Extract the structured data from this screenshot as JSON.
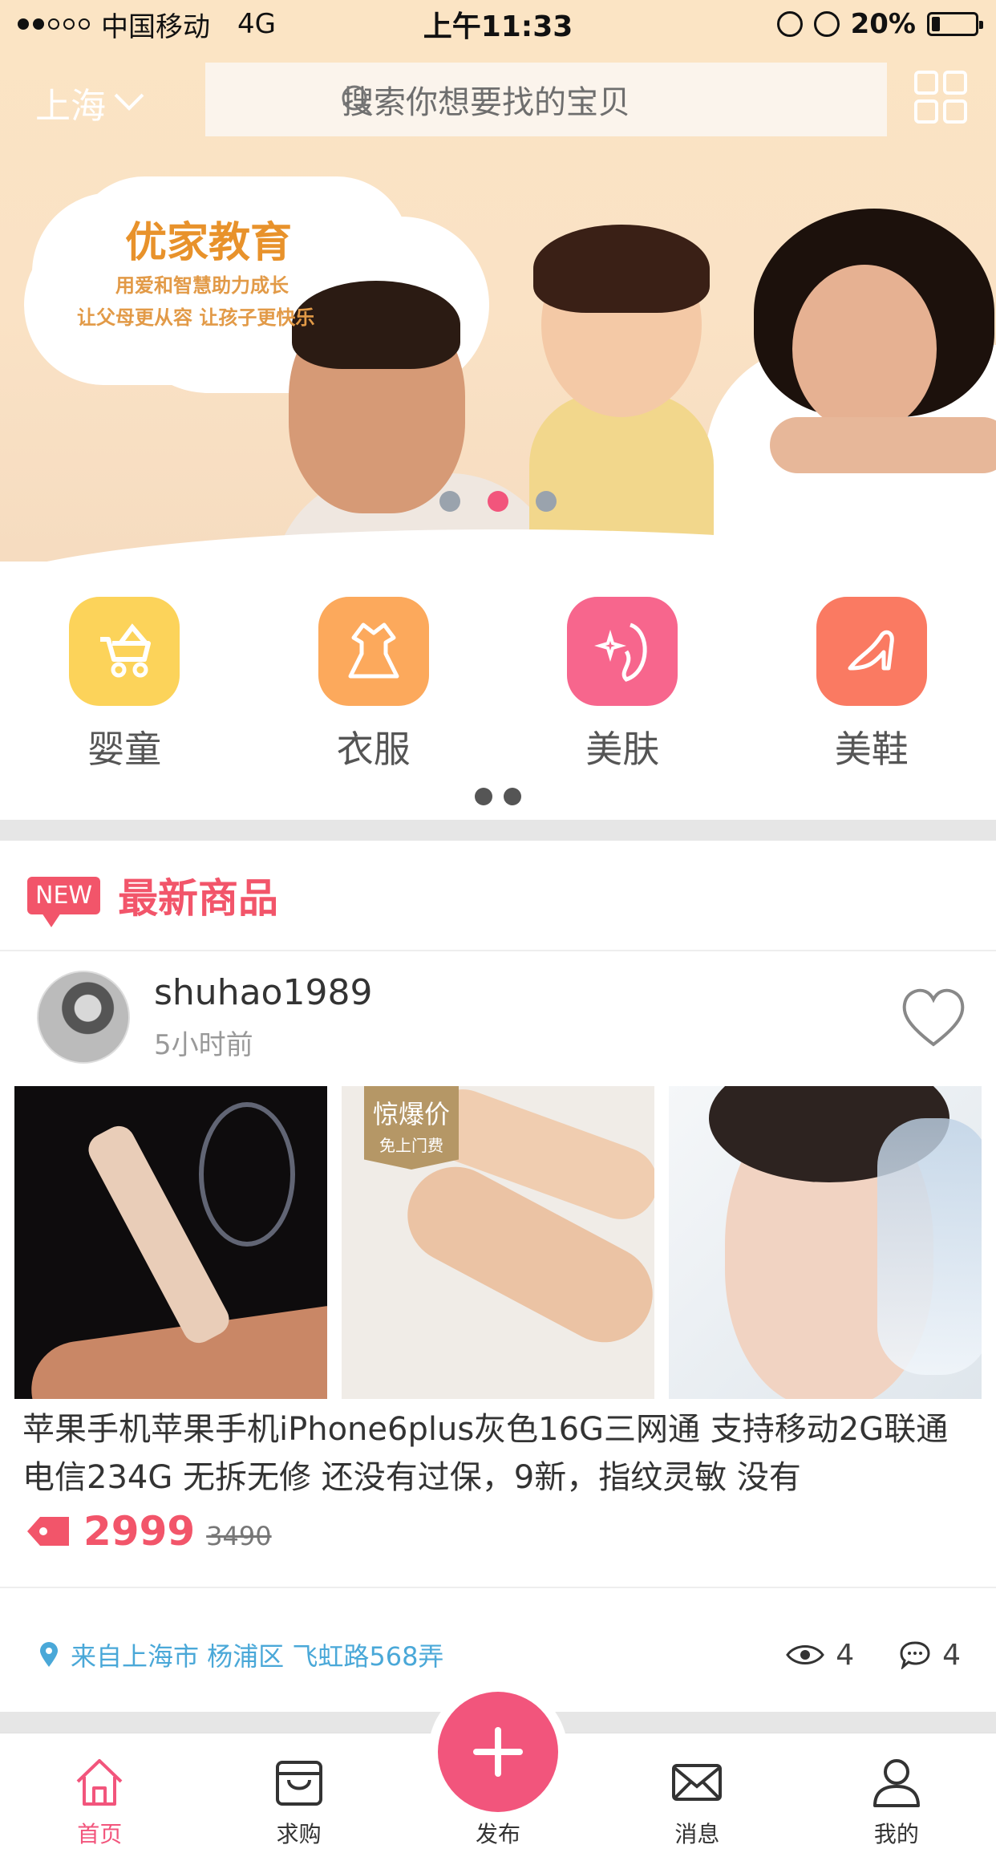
{
  "status_bar": {
    "carrier": "中国移动",
    "network": "4G",
    "time": "上午11:33",
    "battery": "20%",
    "battery_level": 0.2
  },
  "header": {
    "city": "上海",
    "search_placeholder": "搜索你想要找的宝贝"
  },
  "banner": {
    "title": "优家教育",
    "line1": "用爱和智慧助力成长",
    "line2": "让父母更从容  让孩子更快乐",
    "slide_count": 3,
    "active_slide": 2
  },
  "categories": [
    {
      "label": "婴童",
      "icon": "stroller-icon",
      "color": "#fcd35a"
    },
    {
      "label": "衣服",
      "icon": "dress-icon",
      "color": "#fca95c"
    },
    {
      "label": "美肤",
      "icon": "beauty-face-icon",
      "color": "#f7668d"
    },
    {
      "label": "美鞋",
      "icon": "high-heel-icon",
      "color": "#fa7a62"
    }
  ],
  "section": {
    "badge": "NEW",
    "title": "最新商品"
  },
  "product": {
    "username": "shuhao1989",
    "time_ago": "5小时前",
    "photo_tag_line1": "惊爆价",
    "photo_tag_line2": "免上门费",
    "description": "苹果手机苹果手机iPhone6plus灰色16G三网通 支持移动2G联通电信234G 无拆无修 还没有过保，9新，指纹灵敏 没有",
    "price": "2999",
    "old_price": "3490",
    "location": "来自上海市 杨浦区 飞虹路568弄",
    "views": "4",
    "comments": "4"
  },
  "tabbar": {
    "home": "首页",
    "wanted": "求购",
    "publish": "发布",
    "messages": "消息",
    "mine": "我的"
  },
  "colors": {
    "accent": "#f2557c",
    "section_red": "#f2556a",
    "link_blue": "#4aa8d8"
  }
}
